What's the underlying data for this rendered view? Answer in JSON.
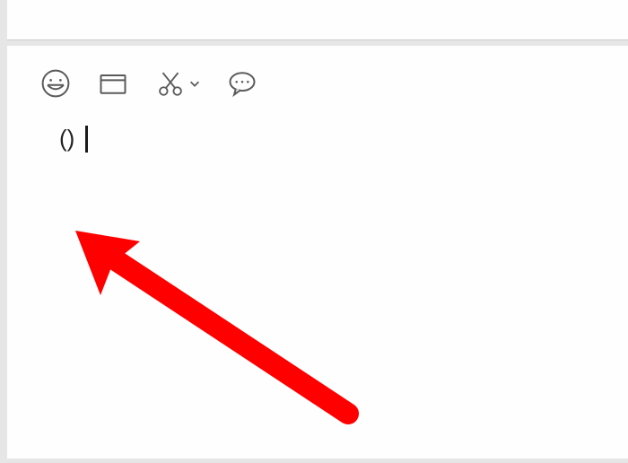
{
  "toolbar": {
    "icons": {
      "emoji": "emoji-icon",
      "folder": "folder-icon",
      "scissors": "scissors-icon",
      "chat": "chat-icon"
    }
  },
  "input": {
    "text": "()"
  },
  "annotation": {
    "color": "#ff0000"
  }
}
